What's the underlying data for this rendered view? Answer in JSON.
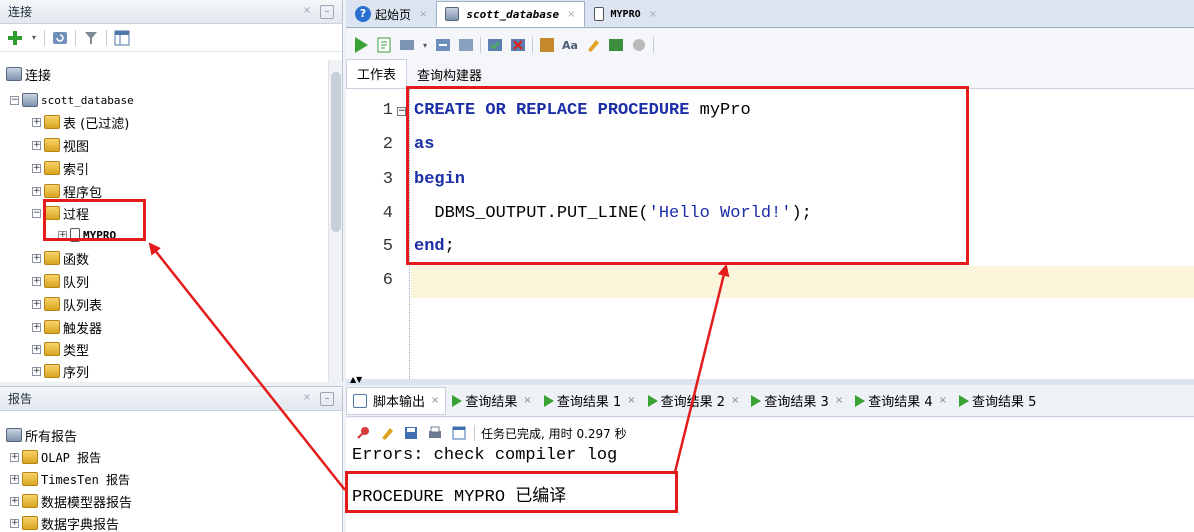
{
  "connections": {
    "title": "连接",
    "root": "连接",
    "db": "scott_database",
    "items": [
      "表 (已过滤)",
      "视图",
      "索引",
      "程序包",
      "过程",
      "函数",
      "队列",
      "队列表",
      "触发器",
      "类型",
      "序列"
    ],
    "selected_child": "MYPRO"
  },
  "reports": {
    "title": "报告",
    "root": "所有报告",
    "items": [
      "OLAP 报告",
      "TimesTen 报告",
      "数据模型器报告",
      "数据字典报告"
    ]
  },
  "tabs": [
    {
      "label": "起始页"
    },
    {
      "label": "scott_database"
    },
    {
      "label": "MYPRO"
    }
  ],
  "subtabs": [
    "工作表",
    "查询构建器"
  ],
  "code": {
    "line_numbers": [
      "1",
      "2",
      "3",
      "4",
      "5",
      "6"
    ],
    "l1_kw": "CREATE OR REPLACE PROCEDURE",
    "l1_name": " myPro",
    "l2_kw": "as",
    "l3_kw": "begin",
    "l4_pre": "  DBMS_OUTPUT.PUT_LINE(",
    "l4_str": "'Hello World!'",
    "l4_post": ");",
    "l5_kw": "end",
    "l5_post": ";"
  },
  "output_tabs": [
    "脚本输出",
    "查询结果",
    "查询结果 1",
    "查询结果 2",
    "查询结果 3",
    "查询结果 4",
    "查询结果 5"
  ],
  "output_status": "任务已完成, 用时 0.297 秒",
  "output_lines": [
    "Errors: check compiler log",
    "PROCEDURE MYPRO 已编译"
  ],
  "colors": {
    "annotation": "#e31b1b",
    "keyword": "#1c2ea6",
    "current_line": "#fbf5dc"
  }
}
